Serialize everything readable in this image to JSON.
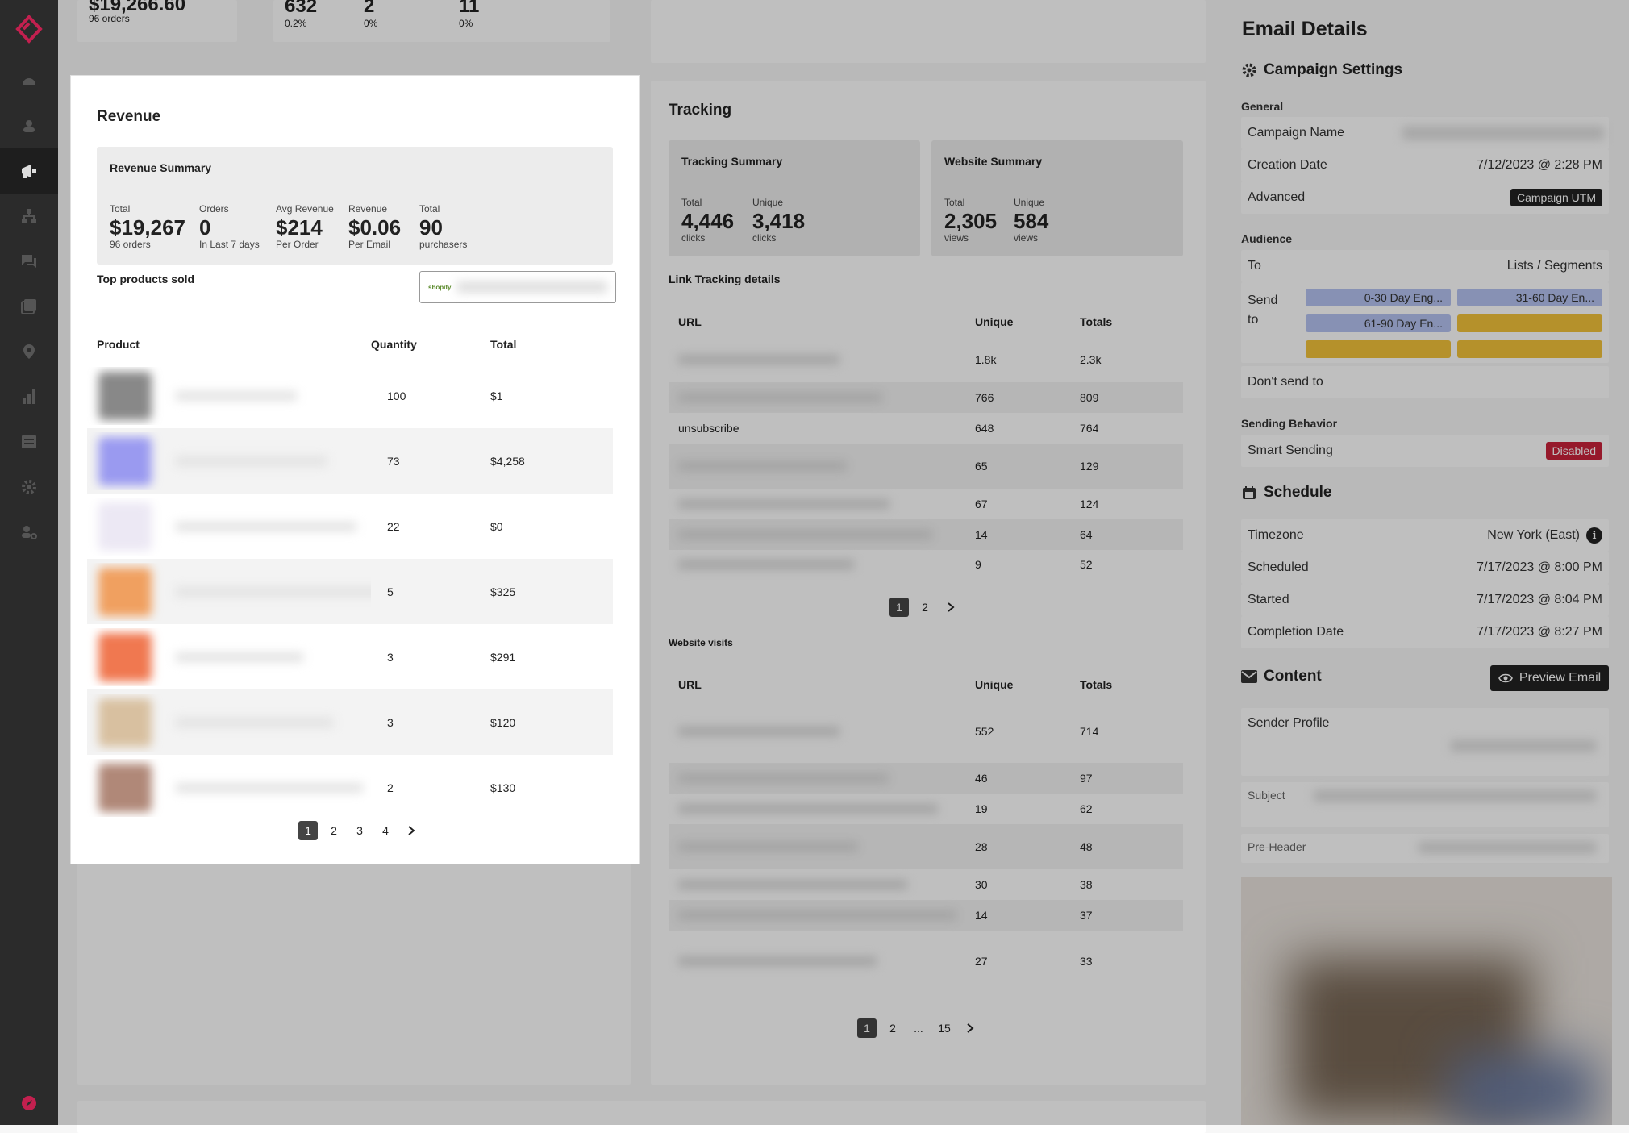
{
  "colors": {
    "accent": "#c3204f",
    "sidebar": "#2b2b2b",
    "tag_dark": "#222222",
    "disabled": "#c8223a"
  },
  "top_strip": {
    "revenue_total": "$19,266.60",
    "revenue_orders": "96 orders",
    "s1_val": "632",
    "s1_pct": "0.2%",
    "s2_val": "2",
    "s2_pct": "0%",
    "s3_val": "11",
    "s3_pct": "0%"
  },
  "revenue": {
    "title": "Revenue",
    "summary_title": "Revenue Summary",
    "stats": [
      {
        "label": "Total",
        "value": "$19,267",
        "sub": "96 orders"
      },
      {
        "label": "Orders",
        "value": "0",
        "sub": "In Last 7 days"
      },
      {
        "label": "Avg Revenue",
        "value": "$214",
        "sub": "Per Order"
      },
      {
        "label": "Revenue",
        "value": "$0.06",
        "sub": "Per Email"
      },
      {
        "label": "Total",
        "value": "90",
        "sub": "purchasers"
      }
    ],
    "top_products_label": "Top products sold",
    "store_badge": "shopify",
    "columns": [
      "Product",
      "Quantity",
      "Total"
    ],
    "rows": [
      {
        "qty": "100",
        "total": "$1",
        "thumb": "#888888"
      },
      {
        "qty": "73",
        "total": "$4,258",
        "thumb": "#9a9af0"
      },
      {
        "qty": "22",
        "total": "$0",
        "thumb": "#ece8f4"
      },
      {
        "qty": "5",
        "total": "$325",
        "thumb": "#f0a060"
      },
      {
        "qty": "3",
        "total": "$291",
        "thumb": "#f07850"
      },
      {
        "qty": "3",
        "total": "$120",
        "thumb": "#d8c0a0"
      },
      {
        "qty": "2",
        "total": "$130",
        "thumb": "#b08878"
      }
    ],
    "pages": [
      "1",
      "2",
      "3",
      "4"
    ],
    "next_icon": "chevron-right-icon"
  },
  "tracking": {
    "title": "Tracking",
    "tracking_summary": {
      "title": "Tracking Summary",
      "stats": [
        {
          "label": "Total",
          "value": "4,446",
          "sub": "clicks"
        },
        {
          "label": "Unique",
          "value": "3,418",
          "sub": "clicks"
        }
      ]
    },
    "website_summary": {
      "title": "Website Summary",
      "stats": [
        {
          "label": "Total",
          "value": "2,305",
          "sub": "views"
        },
        {
          "label": "Unique",
          "value": "584",
          "sub": "views"
        }
      ]
    },
    "link_title": "Link Tracking details",
    "link_columns": [
      "URL",
      "Unique",
      "Totals"
    ],
    "link_rows": [
      {
        "url": "",
        "unique": "1.8k",
        "totals": "2.3k"
      },
      {
        "url": "",
        "unique": "766",
        "totals": "809"
      },
      {
        "url": "unsubscribe",
        "unique": "648",
        "totals": "764"
      },
      {
        "url": "",
        "unique": "65",
        "totals": "129"
      },
      {
        "url": "",
        "unique": "67",
        "totals": "124"
      },
      {
        "url": "",
        "unique": "14",
        "totals": "64"
      },
      {
        "url": "",
        "unique": "9",
        "totals": "52"
      }
    ],
    "link_pages": [
      "1",
      "2"
    ],
    "visits_title": "Website visits",
    "visit_columns": [
      "URL",
      "Unique",
      "Totals"
    ],
    "visit_rows": [
      {
        "unique": "552",
        "totals": "714"
      },
      {
        "unique": "46",
        "totals": "97"
      },
      {
        "unique": "19",
        "totals": "62"
      },
      {
        "unique": "28",
        "totals": "48"
      },
      {
        "unique": "30",
        "totals": "38"
      },
      {
        "unique": "14",
        "totals": "37"
      },
      {
        "unique": "27",
        "totals": "33"
      }
    ],
    "visit_pages": [
      "1",
      "2",
      "...",
      "15"
    ]
  },
  "details": {
    "title": "Email Details",
    "campaign_settings": "Campaign Settings",
    "general": "General",
    "campaign_name_label": "Campaign Name",
    "creation_date_label": "Creation Date",
    "creation_date": "7/12/2023 @ 2:28 PM",
    "advanced_label": "Advanced",
    "advanced_tag": "Campaign UTM",
    "audience": "Audience",
    "to_label": "To",
    "to_value": "Lists / Segments",
    "send_to_label": "Send to",
    "segments": [
      "0-30 Day Eng...",
      "31-60 Day En...",
      "61-90 Day En..."
    ],
    "dont_send_label": "Don't send to",
    "sending_behavior": "Sending Behavior",
    "smart_sending_label": "Smart Sending",
    "smart_sending_tag": "Disabled",
    "schedule": "Schedule",
    "timezone_label": "Timezone",
    "timezone_value": "New York (East)",
    "scheduled_label": "Scheduled",
    "scheduled_value": "7/17/2023 @ 8:00 PM",
    "started_label": "Started",
    "started_value": "7/17/2023 @ 8:04 PM",
    "completion_label": "Completion Date",
    "completion_value": "7/17/2023 @ 8:27 PM",
    "content": "Content",
    "preview_button": "Preview Email",
    "sender_profile_label": "Sender Profile",
    "subject_label": "Subject",
    "preheader_label": "Pre-Header"
  }
}
